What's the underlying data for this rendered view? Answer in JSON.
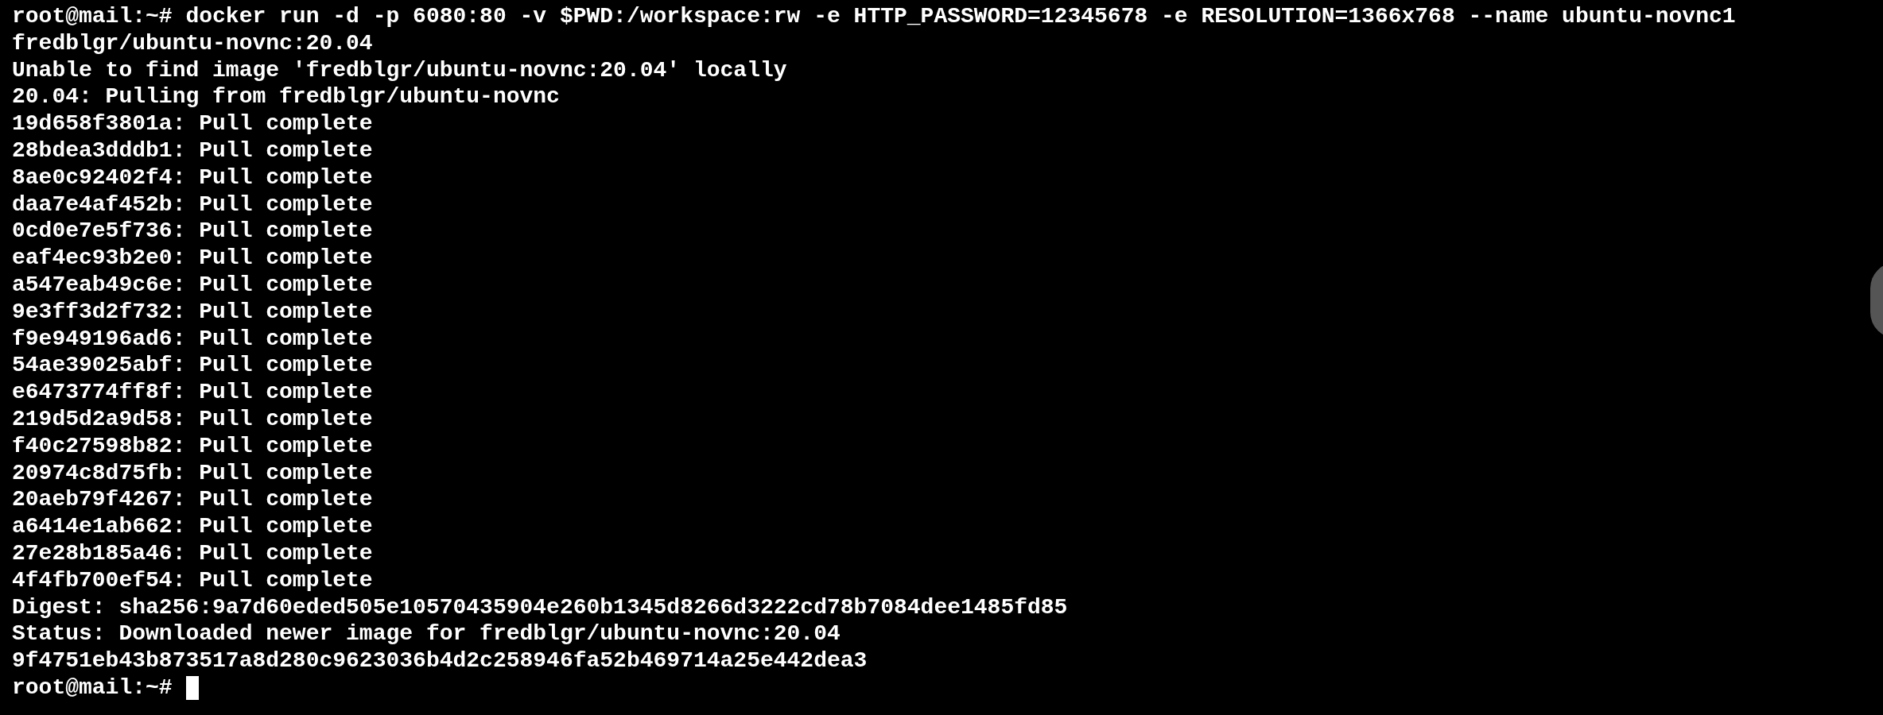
{
  "terminal": {
    "lines": [
      "root@mail:~# docker run -d -p 6080:80 -v $PWD:/workspace:rw -e HTTP_PASSWORD=12345678 -e RESOLUTION=1366x768 --name ubuntu-novnc1",
      "fredblgr/ubuntu-novnc:20.04",
      "Unable to find image 'fredblgr/ubuntu-novnc:20.04' locally",
      "20.04: Pulling from fredblgr/ubuntu-novnc",
      "19d658f3801a: Pull complete",
      "28bdea3dddb1: Pull complete",
      "8ae0c92402f4: Pull complete",
      "daa7e4af452b: Pull complete",
      "0cd0e7e5f736: Pull complete",
      "eaf4ec93b2e0: Pull complete",
      "a547eab49c6e: Pull complete",
      "9e3ff3d2f732: Pull complete",
      "f9e949196ad6: Pull complete",
      "54ae39025abf: Pull complete",
      "e6473774ff8f: Pull complete",
      "219d5d2a9d58: Pull complete",
      "f40c27598b82: Pull complete",
      "20974c8d75fb: Pull complete",
      "20aeb79f4267: Pull complete",
      "a6414e1ab662: Pull complete",
      "27e28b185a46: Pull complete",
      "4f4fb700ef54: Pull complete",
      "Digest: sha256:9a7d60eded505e10570435904e260b1345d8266d3222cd78b7084dee1485fd85",
      "Status: Downloaded newer image for fredblgr/ubuntu-novnc:20.04",
      "9f4751eb43b873517a8d280c9623036b4d2c258946fa52b469714a25e442dea3"
    ],
    "prompt": "root@mail:~#",
    "cursor_visible": true
  }
}
